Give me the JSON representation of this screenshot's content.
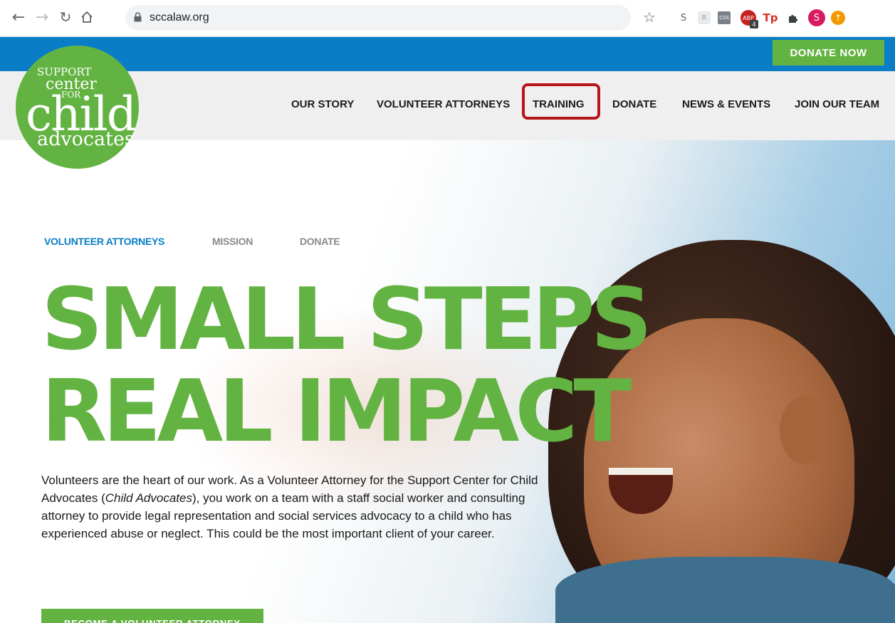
{
  "browser": {
    "url": "sccalaw.org",
    "extensions": [
      {
        "name": "s-ext",
        "label": "S"
      },
      {
        "name": "r-ext",
        "label": "R"
      },
      {
        "name": "css-ext",
        "label": "CSS"
      },
      {
        "name": "abp-ext",
        "label": "ABP",
        "badge": "4"
      },
      {
        "name": "tp-ext",
        "label": "Tp"
      },
      {
        "name": "puzzle-ext",
        "label": ""
      },
      {
        "name": "profile",
        "label": "S"
      },
      {
        "name": "update",
        "label": ""
      }
    ]
  },
  "site": {
    "donate_now": "DONATE NOW",
    "logo": {
      "line1": "SUPPORT",
      "line2": "center",
      "line3": "FOR",
      "line4": "child",
      "line5": "advocates"
    },
    "nav": [
      "OUR STORY",
      "VOLUNTEER ATTORNEYS",
      "TRAINING",
      "DONATE",
      "NEWS & EVENTS",
      "JOIN OUR TEAM"
    ],
    "subnav": [
      "VOLUNTEER ATTORNEYS",
      "MISSION",
      "DONATE"
    ],
    "headline_1": "SMALL STEPS",
    "headline_2": "REAL IMPACT",
    "body_before": "Volunteers are the heart of our work. As a Volunteer Attorney for the Support Center for Child Advocates (",
    "body_em": "Child Advocates",
    "body_after": "), you work on a team with a staff social worker and consulting attorney to provide legal representation and social services advocacy to a child who has experienced abuse or neglect. This could be the most important client of your career.",
    "cta": "BECOME A VOLUNTEER ATTORNEY"
  },
  "colors": {
    "brand_green": "#63b342",
    "brand_blue": "#0a7dc7",
    "highlight_red": "#b8141b"
  }
}
